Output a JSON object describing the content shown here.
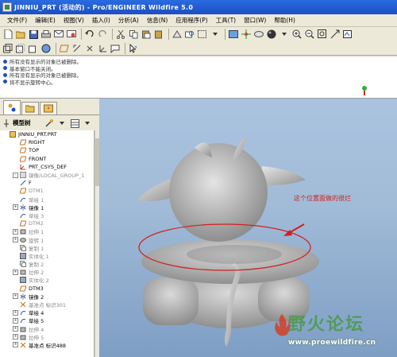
{
  "window": {
    "title": "JINNIU_PRT (活动的) - Pro/ENGINEER Wildfire 5.0"
  },
  "menu": [
    "文件(F)",
    "编辑(E)",
    "视图(V)",
    "插入(I)",
    "分析(A)",
    "信息(N)",
    "应用程序(P)",
    "工具(T)",
    "窗口(W)",
    "帮助(H)"
  ],
  "messages": [
    "所有没有显示的对象已被删除。",
    "基本窗口不能关闭。",
    "所有没有显示的对象已被删除。",
    "将不显示旋转中心。"
  ],
  "model_tree": {
    "title": "模型树",
    "items": [
      {
        "label": "JINNIU_PRT.PRT",
        "icon": "part-icon",
        "dim": false,
        "expander": ""
      },
      {
        "label": "RIGHT",
        "icon": "datum-plane-icon",
        "dim": false,
        "expander": ""
      },
      {
        "label": "TOP",
        "icon": "datum-plane-icon",
        "dim": false,
        "expander": ""
      },
      {
        "label": "FRONT",
        "icon": "datum-plane-icon",
        "dim": false,
        "expander": ""
      },
      {
        "label": "PRT_CSYS_DEF",
        "icon": "csys-icon",
        "dim": false,
        "expander": ""
      },
      {
        "label": "镜像/LOCAL_GROUP_1",
        "icon": "group-icon",
        "dim": true,
        "expander": "-"
      },
      {
        "label": "F",
        "icon": "axis-icon",
        "dim": false,
        "expander": ""
      },
      {
        "label": "DTM1",
        "icon": "datum-plane-icon",
        "dim": true,
        "expander": ""
      },
      {
        "label": "草绘 1",
        "icon": "sketch-icon",
        "dim": true,
        "expander": ""
      },
      {
        "label": "镜像 1",
        "icon": "mirror-icon",
        "dim": false,
        "expander": "+"
      },
      {
        "label": "草绘 3",
        "icon": "sketch-icon",
        "dim": true,
        "expander": ""
      },
      {
        "label": "DTM2",
        "icon": "datum-plane-icon",
        "dim": true,
        "expander": ""
      },
      {
        "label": "拉伸 1",
        "icon": "extrude-icon",
        "dim": true,
        "expander": "+"
      },
      {
        "label": "旋转 1",
        "icon": "revolve-icon",
        "dim": true,
        "expander": "+"
      },
      {
        "label": "复制 1",
        "icon": "copy-icon",
        "dim": true,
        "expander": ""
      },
      {
        "label": "实体化 1",
        "icon": "solidify-icon",
        "dim": true,
        "expander": ""
      },
      {
        "label": "复制 2",
        "icon": "copy-icon",
        "dim": true,
        "expander": ""
      },
      {
        "label": "拉伸 2",
        "icon": "extrude-icon",
        "dim": true,
        "expander": "+"
      },
      {
        "label": "实体化 2",
        "icon": "solidify-icon",
        "dim": true,
        "expander": ""
      },
      {
        "label": "DTM3",
        "icon": "datum-plane-icon",
        "dim": false,
        "expander": ""
      },
      {
        "label": "镜像 2",
        "icon": "mirror-icon",
        "dim": false,
        "expander": "+"
      },
      {
        "label": "基准点 标识301",
        "icon": "datum-point-icon",
        "dim": true,
        "expander": ""
      },
      {
        "label": "草绘 4",
        "icon": "sketch-icon",
        "dim": false,
        "expander": "+"
      },
      {
        "label": "草绘 5",
        "icon": "sketch-icon",
        "dim": false,
        "expander": "+"
      },
      {
        "label": "拉伸 4",
        "icon": "extrude-icon",
        "dim": true,
        "expander": "+"
      },
      {
        "label": "拉伸 5",
        "icon": "extrude-icon",
        "dim": true,
        "expander": "+"
      },
      {
        "label": "基准点 标识488",
        "icon": "datum-point-icon",
        "dim": false,
        "expander": "+"
      }
    ]
  },
  "annotation": {
    "text": "这个位置面做的很烂",
    "color": "#d02020"
  },
  "watermark": {
    "title": "野火论坛",
    "url": "www.proewildfire.cn"
  },
  "colors": {
    "title_bar": "#1c4fc2",
    "viewport_bg": "#a2bcd8",
    "model_grey": "#c8c8c8",
    "accent_red": "#d02020"
  }
}
